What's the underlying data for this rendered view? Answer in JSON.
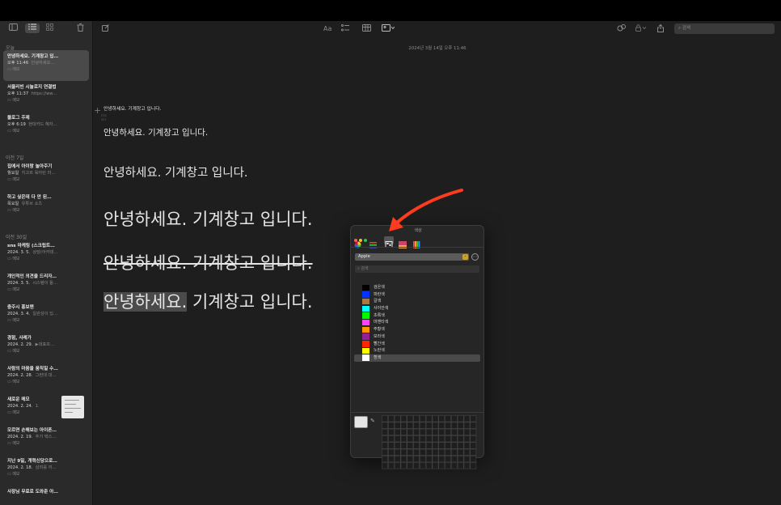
{
  "sidebar": {
    "sections": [
      {
        "label": "오늘",
        "notes": [
          {
            "title": "안녕하세요. 기계창고 입…",
            "time": "오후 11:46",
            "preview": "안녕하세요....",
            "folder": "메모"
          },
          {
            "title": "서울리빈 시놀로지 연결법",
            "time": "오후 11:37",
            "preview": "https://ww...",
            "folder": "메모"
          },
          {
            "title": "블로그 주제",
            "time": "오후 6:19",
            "preview": "현대카드 혜자…",
            "folder": "메모"
          }
        ]
      },
      {
        "label": "이전 7일",
        "notes": [
          {
            "title": "집에서 아이랑 놀아주기",
            "time": "월요일",
            "preview": "지고르 육아린 라…",
            "folder": "메모"
          },
          {
            "title": "하고 싶은데 다 안 된…",
            "time": "목요일",
            "preview": "유튜브 쇼츠",
            "folder": "메모"
          }
        ]
      },
      {
        "label": "이전 30일",
        "notes": [
          {
            "title": "sns 마케팅 (스크립트…",
            "time": "2024. 3. 5.",
            "preview": "상담(아카데…",
            "folder": "메모"
          },
          {
            "title": "개인적인 의견을 드리자…",
            "time": "2024. 3. 5.",
            "preview": "시스템이 들…",
            "folder": "메모"
          },
          {
            "title": "충주시 홍보맨",
            "time": "2024. 3. 4.",
            "preview": "일관성이 있…",
            "folder": "메모"
          },
          {
            "title": "경험, 사례가",
            "time": "2024. 2. 29.",
            "preview": "▶대표프…",
            "folder": "메모"
          },
          {
            "title": "사람의 마음을 움직일 수…",
            "time": "2024. 2. 28.",
            "preview": "그런데 대…",
            "folder": "메모"
          },
          {
            "title": "새로운 메모",
            "time": "2024. 2. 24.",
            "preview": "1.",
            "folder": "메모"
          },
          {
            "title": "모르면 손해보는 아이폰…",
            "time": "2024. 2. 19.",
            "preview": "추가 텍스…",
            "folder": "메모"
          },
          {
            "title": "지난 9일, 개혁신당으로…",
            "time": "2024. 2. 18.",
            "preview": "심려를 끼…",
            "folder": "메모"
          }
        ]
      }
    ],
    "partial_note_title": "사장님 무료로 도와준 아…"
  },
  "toolbar": {
    "format_label": "Aa",
    "search_placeholder": "검색"
  },
  "editor": {
    "date": "2024년 3월 14일 오후 11:46",
    "coord_x": "272",
    "coord_y": "317",
    "lines": [
      "안녕하세요. 기계창고 입니다.",
      "안녕하세요. 기계창고 입니다.",
      "안녕하세요. 기계창고 입니다.",
      "안녕하세요. 기계창고 입니다.",
      "안녕하세요. 기계창고 입니다."
    ],
    "last_line_highlight": "안녕하세요.",
    "last_line_rest": " 기계창고 입니다."
  },
  "color_panel": {
    "title": "색상",
    "palette": "Apple",
    "search_placeholder": "검색",
    "colors": [
      {
        "name": "검은색",
        "hex": "#000000"
      },
      {
        "name": "파란색",
        "hex": "#0433ff"
      },
      {
        "name": "갈색",
        "hex": "#aa7942"
      },
      {
        "name": "사이안색",
        "hex": "#00fdff"
      },
      {
        "name": "초록색",
        "hex": "#00f900"
      },
      {
        "name": "마젠타색",
        "hex": "#ff40ff"
      },
      {
        "name": "주황색",
        "hex": "#ff9300"
      },
      {
        "name": "보라색",
        "hex": "#942192"
      },
      {
        "name": "빨간색",
        "hex": "#ff2600"
      },
      {
        "name": "노란색",
        "hex": "#fffb00"
      },
      {
        "name": "흰색",
        "hex": "#ffffff"
      }
    ],
    "selected_color": "흰색"
  },
  "annotation_color": "#ff3b1f"
}
